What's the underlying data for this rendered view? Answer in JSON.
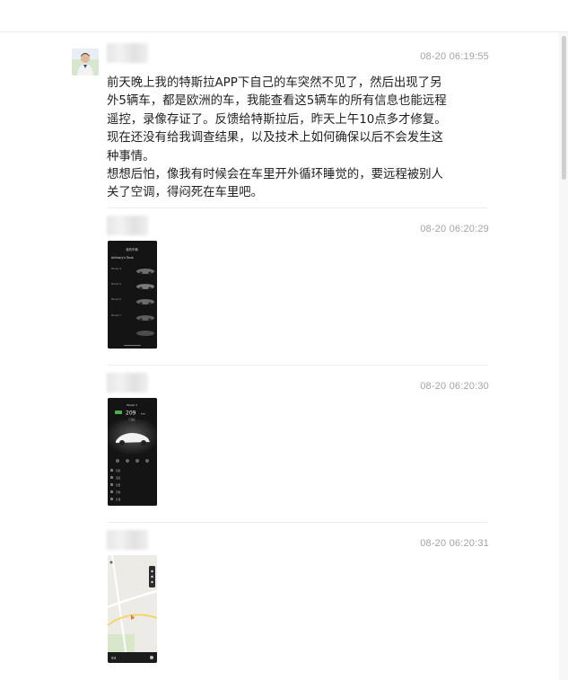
{
  "messages": [
    {
      "timestamp": "08-20 06:19:55",
      "lines": [
        "前天晚上我的特斯拉APP下自己的车突然不见了，然后出现了另",
        "外5辆车，都是欧洲的车，我能查看这5辆车的所有信息也能远程",
        "遥控，录像存证了。反馈给特斯拉后，昨天上午10点多才修复。",
        "现在还没有给我调查结果，以及技术上如何确保以后不会发生这",
        "种事情。",
        "想想后怕，像我有时候会在车里开外循环睡觉的，要远程被别人",
        "关了空调，得闷死在车里吧。"
      ]
    },
    {
      "timestamp": "08-20 06:20:29"
    },
    {
      "timestamp": "08-20 06:20:30"
    },
    {
      "timestamp": "08-20 06:20:31"
    }
  ],
  "screenshot_1": {
    "header": "我的车辆",
    "owner": "Anthony's Tesla",
    "vehicles": [
      "Model 3",
      "Model S",
      "Model X",
      "Model Y"
    ]
  },
  "screenshot_2": {
    "car_name": "Model 3",
    "battery": "209",
    "unit": "km",
    "status": "已锁定",
    "menu": [
      "控制",
      "温度",
      "位置",
      "召唤",
      "升级"
    ]
  },
  "screenshot_3": {
    "button": "按钮"
  }
}
